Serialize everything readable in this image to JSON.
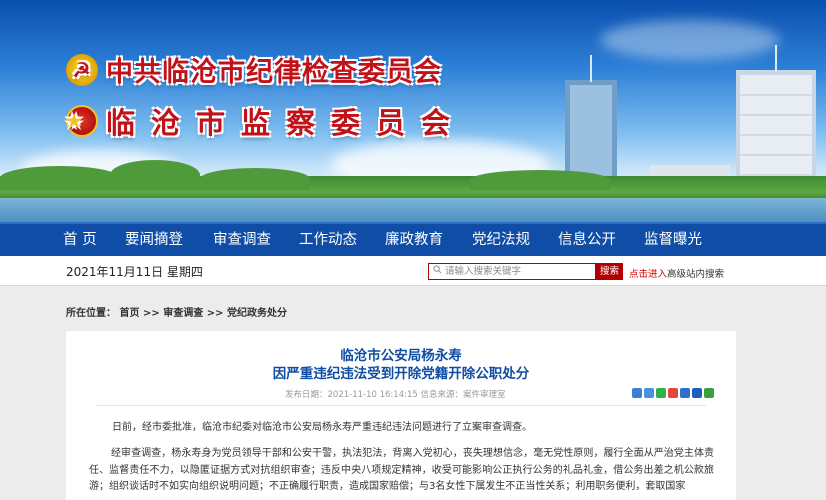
{
  "banner": {
    "title_line1": "中共临沧市纪律检查委员会",
    "title_line2": "临沧市监察委员会"
  },
  "nav": {
    "items": [
      "首 页",
      "要闻摘登",
      "审查调查",
      "工作动态",
      "廉政教育",
      "党纪法规",
      "信息公开",
      "监督曝光"
    ]
  },
  "infobar": {
    "date": "2021年11月11日 星期四",
    "search_placeholder": "请输入搜索关键字",
    "search_button": "搜索",
    "adv_click": "点击进入",
    "adv_label": "高级站内搜索"
  },
  "breadcrumb": {
    "prefix": "所在位置：",
    "items": [
      "首页",
      "审查调查",
      "党纪政务处分"
    ],
    "separator": ">>"
  },
  "article": {
    "title_line1": "临沧市公安局杨永寿",
    "title_line2": "因严重违纪违法受到开除党籍开除公职处分",
    "meta": "发布日期：2021-11-10 16:14:15   信息来源：案件审理室",
    "paragraph1": "日前，经市委批准，临沧市纪委对临沧市公安局杨永寿严重违纪违法问题进行了立案审查调查。",
    "paragraph2": "经审查调查，杨永寿身为党员领导干部和公安干警，执法犯法，背离入党初心，丧失理想信念，毫无党性原则，履行全面从严治党主体责任、监督责任不力，以隐匿证据方式对抗组织审查；违反中央八项规定精神，收受可能影响公正执行公务的礼品礼金，借公务出差之机公款旅游；组织谈话时不如实向组织说明问题；不正确履行职责，造成国家赔偿；与3名女性下属发生不正当性关系；利用职务便利，套取国家"
  },
  "colors": {
    "nav_bg": "#0f4da6",
    "title_red": "#c1121a",
    "headline_blue": "#104ea3",
    "search_red": "#b20000"
  },
  "icons": [
    "party-emblem-icon",
    "national-emblem-icon",
    "search-icon",
    "share-icons"
  ]
}
